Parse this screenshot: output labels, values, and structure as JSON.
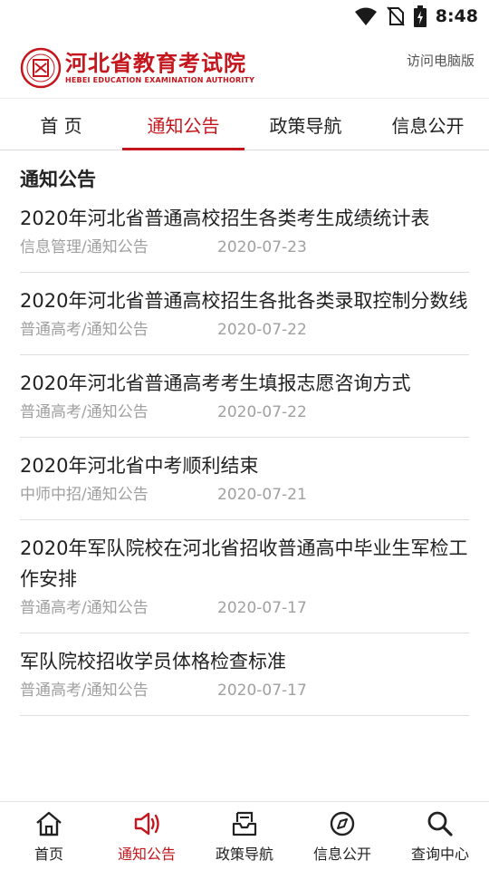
{
  "status_bar": {
    "time": "8:48",
    "icons": [
      "wifi-icon",
      "no-sim-icon",
      "battery-icon"
    ]
  },
  "header": {
    "logo_cn": "河北省教育考试院",
    "logo_en": "HEBEI EDUCATION EXAMINATION AUTHORITY",
    "desktop_link": "访问电脑版"
  },
  "top_nav": {
    "tabs": [
      {
        "label": "首 页",
        "active": false
      },
      {
        "label": "通知公告",
        "active": true
      },
      {
        "label": "政策导航",
        "active": false
      },
      {
        "label": "信息公开",
        "active": false
      }
    ]
  },
  "section": {
    "title": "通知公告"
  },
  "list": [
    {
      "title": "2020年河北省普通高校招生各类考生成绩统计表",
      "category": "信息管理/通知公告",
      "date": "2020-07-23"
    },
    {
      "title": "2020年河北省普通高校招生各批各类录取控制分数线",
      "category": "普通高考/通知公告",
      "date": "2020-07-22"
    },
    {
      "title": "2020年河北省普通高考考生填报志愿咨询方式",
      "category": "普通高考/通知公告",
      "date": "2020-07-22"
    },
    {
      "title": "2020年河北省中考顺利结束",
      "category": "中师中招/通知公告",
      "date": "2020-07-21"
    },
    {
      "title": "2020年军队院校在河北省招收普通高中毕业生军检工作安排",
      "category": "普通高考/通知公告",
      "date": "2020-07-17"
    },
    {
      "title": "军队院校招收学员体格检查标准",
      "category": "普通高考/通知公告",
      "date": "2020-07-17"
    }
  ],
  "bottom_nav": {
    "items": [
      {
        "label": "首页",
        "icon": "home-icon",
        "active": false
      },
      {
        "label": "通知公告",
        "icon": "speaker-icon",
        "active": true
      },
      {
        "label": "政策导航",
        "icon": "inbox-icon",
        "active": false
      },
      {
        "label": "信息公开",
        "icon": "compass-icon",
        "active": false
      },
      {
        "label": "查询中心",
        "icon": "search-icon",
        "active": false
      }
    ]
  },
  "colors": {
    "accent": "#c4161c",
    "meta_text": "#a0a0a0",
    "divider": "#dedede"
  }
}
